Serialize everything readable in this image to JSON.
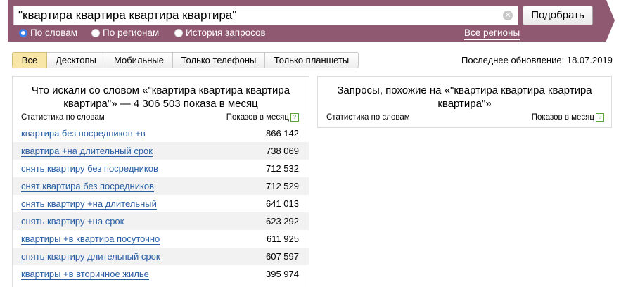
{
  "search": {
    "query": "\"квартира квартира квартира квартира\"",
    "clear_icon": "clear-icon",
    "submit_label": "Подобрать",
    "modes": [
      {
        "label": "По словам",
        "selected": true
      },
      {
        "label": "По регионам",
        "selected": false
      },
      {
        "label": "История запросов",
        "selected": false
      }
    ],
    "regions_link": "Все регионы"
  },
  "colors": {
    "band": "#8f5a71",
    "active_tab": "#f8e5a8",
    "link": "#2a5fa3",
    "radio_selected": "#3d7ee9"
  },
  "tabs": [
    {
      "label": "Все",
      "active": true
    },
    {
      "label": "Десктопы",
      "active": false
    },
    {
      "label": "Мобильные",
      "active": false
    },
    {
      "label": "Только телефоны",
      "active": false
    },
    {
      "label": "Только планшеты",
      "active": false
    }
  ],
  "last_update": "Последнее обновление: 18.07.2019",
  "left_panel": {
    "title_line1": "Что искали со словом «\"квартира квартира квартира",
    "title_line2": "квартира\"» — 4 306 503 показа в месяц",
    "col_words": "Статистика по словам",
    "col_shows": "Показов в месяц",
    "rows": [
      {
        "query": "квартира без посредников +в",
        "count": "866 142"
      },
      {
        "query": "квартира +на длительный срок",
        "count": "738 069"
      },
      {
        "query": "снять квартиру без посредников",
        "count": "712 532"
      },
      {
        "query": "снят квартира без посредников",
        "count": "712 529"
      },
      {
        "query": "снять квартиру +на длительный",
        "count": "641 013"
      },
      {
        "query": "снять квартиру +на срок",
        "count": "623 292"
      },
      {
        "query": "квартиры +в квартира посуточно",
        "count": "611 925"
      },
      {
        "query": "снять квартиру длительный срок",
        "count": "607 597"
      },
      {
        "query": "квартиры +в вторичное жилье",
        "count": "395 974"
      }
    ]
  },
  "right_panel": {
    "title_line1": "Запросы, похожие на «\"квартира квартира квартира",
    "title_line2": "квартира\"»",
    "col_words": "Статистика по словам",
    "col_shows": "Показов в месяц"
  },
  "help_icon_glyph": "?"
}
